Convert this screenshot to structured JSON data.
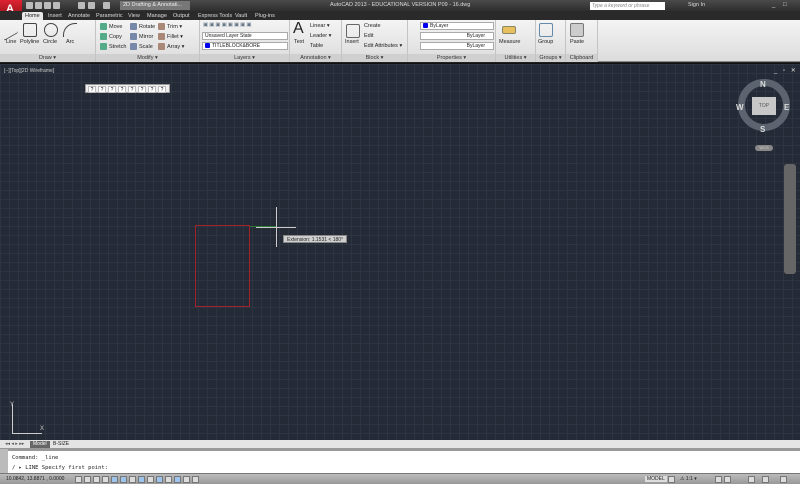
{
  "titlebar": {
    "workspace": "2D Drafting & Annotati...",
    "title": "AutoCAD 2013 - EDUCATIONAL VERSION    P09 - 16.dwg",
    "search_placeholder": "Type a keyword or phrase",
    "sign_in": "Sign In",
    "window_controls": "_ □ ✕"
  },
  "tabs": [
    "Home",
    "Insert",
    "Annotate",
    "Parametric",
    "View",
    "Manage",
    "Output",
    "Express Tools",
    "Vault",
    "Plug-ins"
  ],
  "ribbon": {
    "draw": {
      "label": "Draw ▾",
      "items": [
        "Line",
        "Polyline",
        "Circle",
        "Arc"
      ]
    },
    "modify": {
      "label": "Modify ▾",
      "items": [
        "Move",
        "Rotate",
        "Trim ▾",
        "Copy",
        "Mirror",
        "Fillet ▾",
        "Stretch",
        "Scale",
        "Array ▾"
      ]
    },
    "layers": {
      "label": "Layers ▾",
      "layer_state": "Unsaved Layer State",
      "current_layer": "TITLEBLOCK&BORE"
    },
    "annotation": {
      "label": "Annotation ▾",
      "items": [
        "Text",
        "Linear ▾",
        "Leader ▾",
        "Table"
      ]
    },
    "block": {
      "label": "Block ▾",
      "items": [
        "Insert",
        "Create",
        "Edit",
        "Edit Attributes ▾"
      ]
    },
    "properties": {
      "label": "Properties ▾",
      "color": "ByLayer",
      "linetype": "ByLayer",
      "lineweight": "ByLayer",
      "color_swatch": "#0000ee"
    },
    "utilities": {
      "label": "Utilities ▾",
      "items": [
        "Measure"
      ]
    },
    "groups": {
      "label": "Groups ▾",
      "items": [
        "Group"
      ]
    },
    "clipboard": {
      "label": "Clipboard",
      "items": [
        "Paste"
      ]
    }
  },
  "viewport": {
    "label": "[−][Top][2D Wireframe]",
    "quick_toolbar": [
      "?",
      "?",
      "?",
      "?",
      "?",
      "?",
      "?",
      "?"
    ],
    "tooltip": "Extension: 1.1531 < 180°",
    "viewcube": {
      "face": "TOP",
      "n": "N",
      "s": "S",
      "e": "E",
      "w": "W",
      "wcs": "WCS"
    },
    "ucs_x": "X",
    "ucs_y": "Y",
    "controls": "_ ▫ ✕"
  },
  "layout_tabs": {
    "nav": "◂◂ ◂ ▸ ▸▸",
    "model": "Model",
    "layout": "B-SIZE"
  },
  "command": {
    "history": "Command:  _line",
    "prompt": "LINE Specify first point:"
  },
  "status": {
    "coords": "10.0842, 13.8871 , 0.0000",
    "model": "MODEL",
    "scale": "⚠ 1:1 ▾"
  },
  "colors": {
    "background": "#252b36",
    "rectangle": "#a0222a",
    "accent": "#9cc4ec"
  }
}
